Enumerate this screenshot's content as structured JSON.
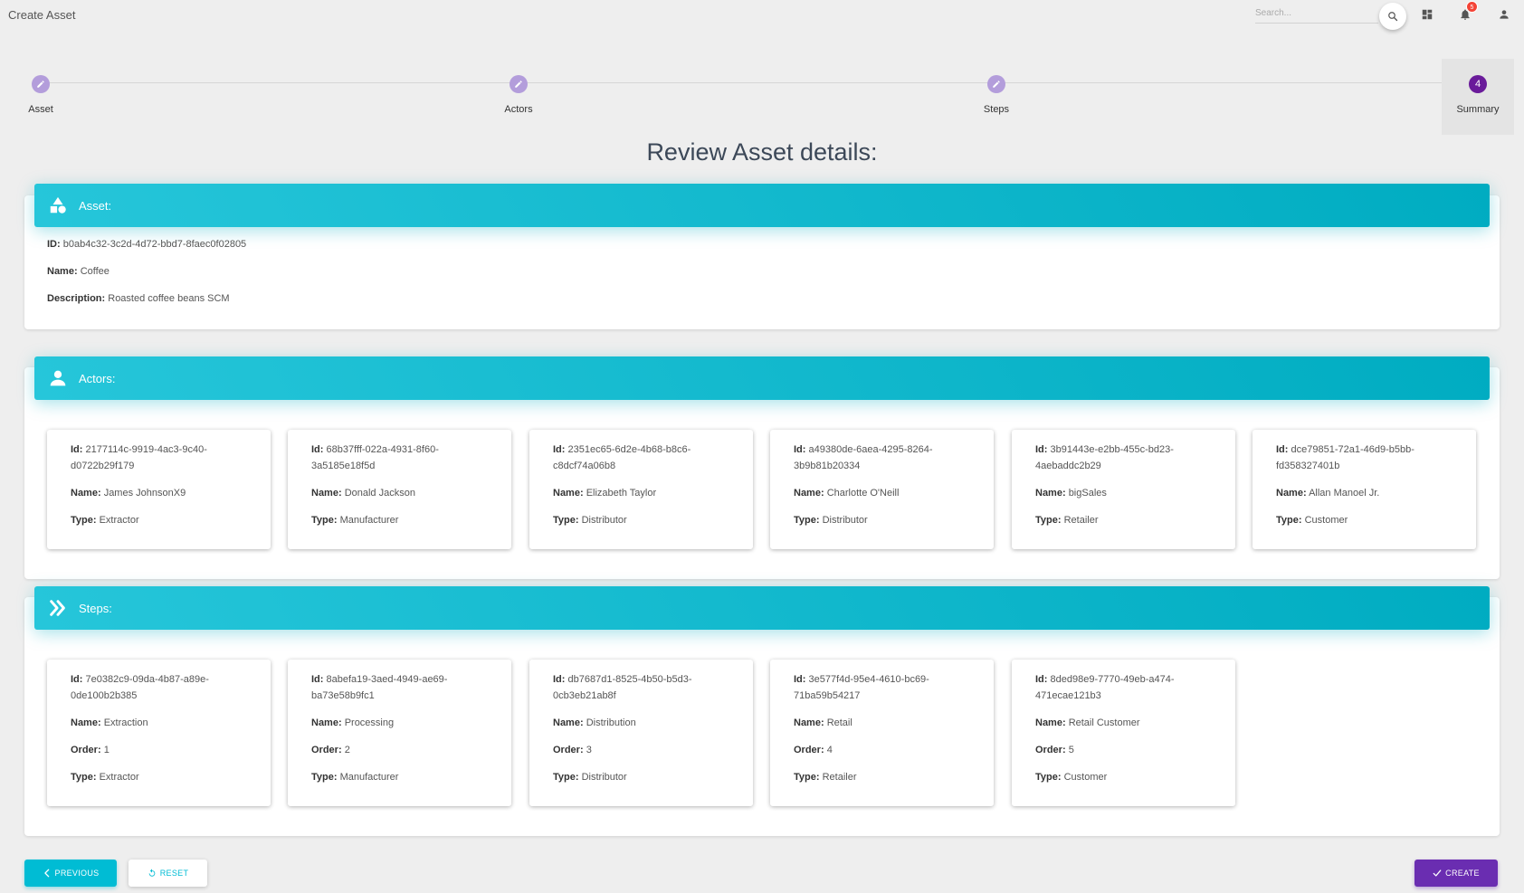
{
  "header": {
    "title": "Create Asset",
    "search_placeholder": "Search...",
    "notifications_count": "5"
  },
  "stepper": {
    "steps": [
      {
        "label": "Asset",
        "state": "done"
      },
      {
        "label": "Actors",
        "state": "done"
      },
      {
        "label": "Steps",
        "state": "done"
      },
      {
        "label": "Summary",
        "state": "active",
        "number": "4"
      }
    ]
  },
  "review_title": "Review Asset details:",
  "asset_section": {
    "title": "Asset:",
    "id_label": "ID:",
    "id": "b0ab4c32-3c2d-4d72-bbd7-8faec0f02805",
    "name_label": "Name:",
    "name": "Coffee",
    "description_label": "Description:",
    "description": "Roasted coffee beans SCM"
  },
  "actors_section": {
    "title": "Actors:",
    "id_label": "Id:",
    "name_label": "Name:",
    "type_label": "Type:",
    "actors": [
      {
        "id_line1": "2177114c-9919-4ac3-9c40-",
        "id_line2": "d0722b29f179",
        "name": "James JohnsonX9",
        "type": "Extractor"
      },
      {
        "id_line1": "68b37fff-022a-4931-8f60-",
        "id_line2": "3a5185e18f5d",
        "name": "Donald Jackson",
        "type": "Manufacturer"
      },
      {
        "id_line1": "2351ec65-6d2e-4b68-b8c6-",
        "id_line2": "c8dcf74a06b8",
        "name": "Elizabeth Taylor",
        "type": "Distributor"
      },
      {
        "id_line1": "a49380de-6aea-4295-8264-",
        "id_line2": "3b9b81b20334",
        "name": "Charlotte O'Neill",
        "type": "Distributor"
      },
      {
        "id_line1": "3b91443e-e2bb-455c-bd23-",
        "id_line2": "4aebaddc2b29",
        "name": "bigSales",
        "type": "Retailer"
      },
      {
        "id_line1": "dce79851-72a1-46d9-b5bb-",
        "id_line2": "fd358327401b",
        "name": "Allan Manoel Jr.",
        "type": "Customer"
      }
    ]
  },
  "steps_section": {
    "title": "Steps:",
    "id_label": "Id:",
    "name_label": "Name:",
    "order_label": "Order:",
    "type_label": "Type:",
    "steps": [
      {
        "id_line1": "7e0382c9-09da-4b87-a89e-",
        "id_line2": "0de100b2b385",
        "name": "Extraction",
        "order": "1",
        "type": "Extractor"
      },
      {
        "id_line1": "8abefa19-3aed-4949-ae69-",
        "id_line2": "ba73e58b9fc1",
        "name": "Processing",
        "order": "2",
        "type": "Manufacturer"
      },
      {
        "id_line1": "db7687d1-8525-4b50-b5d3-",
        "id_line2": "0cb3eb21ab8f",
        "name": "Distribution",
        "order": "3",
        "type": "Distributor"
      },
      {
        "id_line1": "3e577f4d-95e4-4610-bc69-",
        "id_line2": "71ba59b54217",
        "name": "Retail",
        "order": "4",
        "type": "Retailer"
      },
      {
        "id_line1": "8ded98e9-7770-49eb-a474-",
        "id_line2": "471ecae121b3",
        "name": "Retail Customer",
        "order": "5",
        "type": "Customer"
      }
    ]
  },
  "footer": {
    "previous_label": "PREVIOUS",
    "reset_label": "RESET",
    "create_label": "CREATE"
  },
  "colors": {
    "header_gradient_start": "#26c6da",
    "header_gradient_end": "#00acc1",
    "step_done": "#b39ddb",
    "step_active": "#6a1b9a",
    "create_button": "#6a2db1",
    "previous_button": "#00bcd4"
  }
}
